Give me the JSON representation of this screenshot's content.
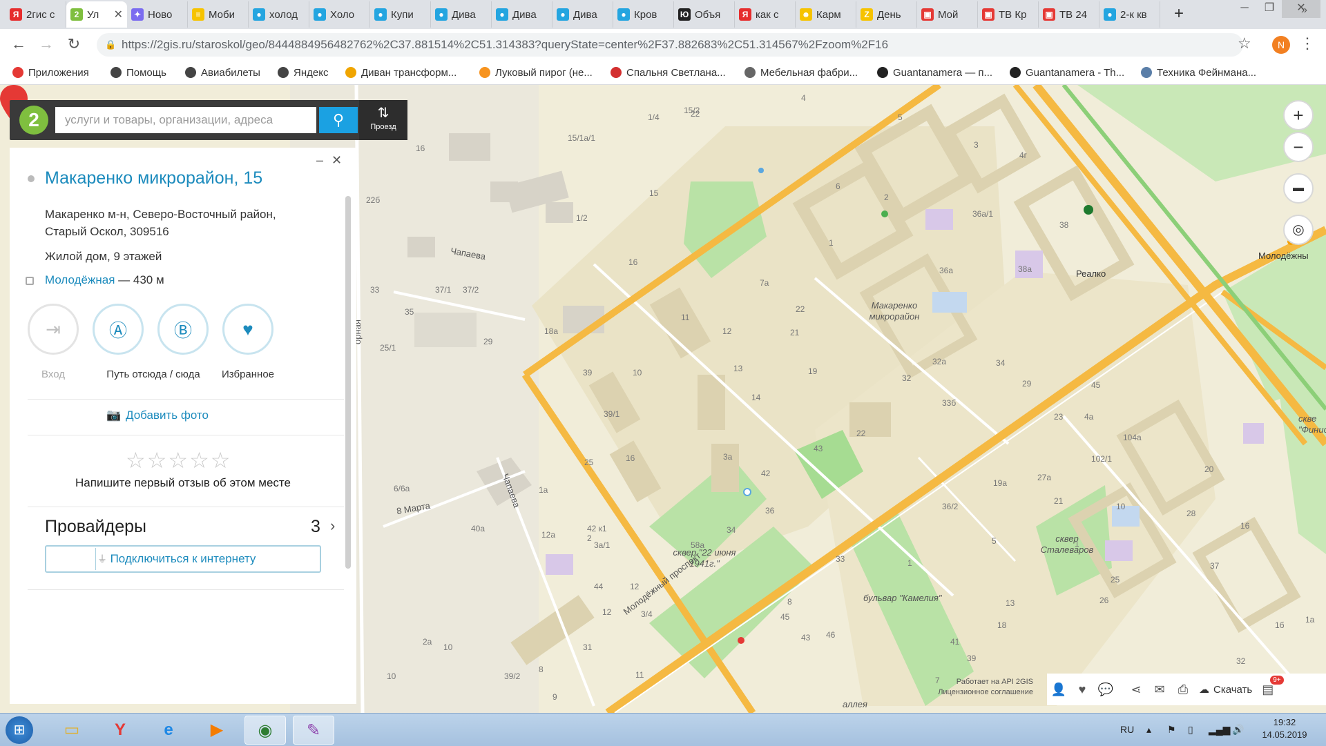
{
  "browser": {
    "tabs": [
      {
        "label": "2гис с",
        "icon": "yandex-icon",
        "color": "#e62d2d",
        "glyph": "Я"
      },
      {
        "label": "Ул",
        "icon": "2gis-icon",
        "color": "#7fbf3f",
        "glyph": "2",
        "active": true
      },
      {
        "label": "Ново",
        "icon": "gemini-icon",
        "color": "#7b6cf0",
        "glyph": "✦"
      },
      {
        "label": "Моби",
        "icon": "beeline-icon",
        "color": "#f6c300",
        "glyph": "≡"
      },
      {
        "label": "холод",
        "icon": "avito-icon",
        "color": "#24a5e0",
        "glyph": "●"
      },
      {
        "label": "Холо",
        "icon": "avito-icon",
        "color": "#24a5e0",
        "glyph": "●"
      },
      {
        "label": "Купи",
        "icon": "avito-icon",
        "color": "#24a5e0",
        "glyph": "●"
      },
      {
        "label": "Дива",
        "icon": "avito-icon",
        "color": "#24a5e0",
        "glyph": "●"
      },
      {
        "label": "Дива",
        "icon": "avito-icon",
        "color": "#24a5e0",
        "glyph": "●"
      },
      {
        "label": "Дива",
        "icon": "avito-icon",
        "color": "#24a5e0",
        "glyph": "●"
      },
      {
        "label": "Кров",
        "icon": "avito-icon",
        "color": "#24a5e0",
        "glyph": "●"
      },
      {
        "label": "Объя",
        "icon": "youla-icon",
        "color": "#222222",
        "glyph": "Ю"
      },
      {
        "label": "как с",
        "icon": "yandex-icon",
        "color": "#e62d2d",
        "glyph": "Я"
      },
      {
        "label": "Карм",
        "icon": "smile-icon",
        "color": "#f6c300",
        "glyph": "☻"
      },
      {
        "label": "День",
        "icon": "yandex-zen-icon",
        "color": "#f6c300",
        "glyph": "Z"
      },
      {
        "label": "Мой",
        "icon": "tv-icon",
        "color": "#e53935",
        "glyph": "▣"
      },
      {
        "label": "ТВ Кр",
        "icon": "tv-icon",
        "color": "#e53935",
        "glyph": "▣"
      },
      {
        "label": "ТВ 24",
        "icon": "tv-icon",
        "color": "#e53935",
        "glyph": "▣"
      },
      {
        "label": "2-к кв",
        "icon": "avito-icon",
        "color": "#24a5e0",
        "glyph": "●"
      }
    ],
    "url": "https://2gis.ru/staroskol/geo/8444884956482762%2C37.881514%2C51.314383?queryState=center%2F37.882683%2C51.314567%2Fzoom%2F16",
    "profile_initial": "N",
    "bookmarks": [
      {
        "label": "Приложения",
        "icon": "apps-grid-icon",
        "color": "#e53935"
      },
      {
        "label": "Помощь",
        "icon": "globe-icon",
        "color": "#444444"
      },
      {
        "label": "Авиабилеты",
        "icon": "globe-icon",
        "color": "#444444"
      },
      {
        "label": "Яндекс",
        "icon": "globe-icon",
        "color": "#444444"
      },
      {
        "label": "Диван трансформ...",
        "icon": "sofa-icon",
        "color": "#f0a500"
      },
      {
        "label": "Луковый пирог (не...",
        "icon": "odnoklassniki-icon",
        "color": "#f7931e"
      },
      {
        "label": "Спальня Светлана...",
        "icon": "bookmark-icon",
        "color": "#d32f2f"
      },
      {
        "label": "Мебельная фабри...",
        "icon": "bookmark-icon",
        "color": "#666666"
      },
      {
        "label": "Guantanamera — п...",
        "icon": "youtube-icon",
        "color": "#222222"
      },
      {
        "label": "Guantanamera - Th...",
        "icon": "youtube-icon",
        "color": "#222222"
      },
      {
        "label": "Техника Фейнмана...",
        "icon": "book-icon",
        "color": "#5a7ea8"
      }
    ]
  },
  "search": {
    "placeholder": "услуги и товары, организации, адреса",
    "route_label": "Проезд"
  },
  "card": {
    "title": "Макаренко микрорайон, 15",
    "address_line1": "Макаренко м-н, Северо-Восточный район,",
    "address_line2": "Старый Оскол, 309516",
    "building_type": "Жилой дом, 9 этажей",
    "stop_name": "Молодёжная",
    "stop_distance": "— 430 м",
    "actions": {
      "entrance": "Вход",
      "route": "Путь отсюда / сюда",
      "favorites": "Избранное"
    },
    "add_photo": "Добавить фото",
    "review_prompt": "Напишите первый отзыв об этом месте",
    "providers_title": "Провайдеры",
    "providers_count": "3",
    "connect_label": "Подключиться к интернету"
  },
  "map": {
    "labels": {
      "district": "Макаренко микрорайон",
      "realko": "Реалко",
      "molodezhny": "Молодёжны",
      "chapaeva1": "Чапаева",
      "chapaeva2": "Чапаева",
      "march8": "8 Марта",
      "prospekt": "Молодёжный проспект",
      "skver22": "сквер \"22 июня 1941г.\"",
      "skverStal": "сквер Сталеваров",
      "bulvar": "бульвар \"Камелия\"",
      "ornaya": "орная",
      "skverRight": "скве \"Финис",
      "alleya": "аллея"
    },
    "houses": [
      "15/2",
      "22",
      "4",
      "5",
      "1/4",
      "15/1а/1",
      "16",
      "3",
      "22б",
      "1/2",
      "4г",
      "6",
      "2",
      "36а/1",
      "38",
      "15",
      "16",
      "1",
      "36а",
      "38а",
      "7а",
      "22",
      "11",
      "12",
      "21",
      "37/1",
      "37/2",
      "35",
      "18а",
      "25/1",
      "33",
      "29",
      "10",
      "39",
      "13",
      "19",
      "32а",
      "34",
      "32",
      "33б",
      "14",
      "29",
      "45",
      "39/1",
      "22",
      "23",
      "4а",
      "43",
      "3а",
      "16",
      "25",
      "27а",
      "104а",
      "6/6а",
      "1а",
      "42",
      "19а",
      "21",
      "36/2",
      "10",
      "28",
      "20",
      "1",
      "102/1",
      "3а/1",
      "42 к1",
      "40а",
      "58а",
      "34",
      "36",
      "33",
      "5",
      "1",
      "16",
      "12а",
      "2",
      "44",
      "12",
      "8",
      "13",
      "12",
      "3/4",
      "45",
      "43",
      "46",
      "41",
      "39",
      "18",
      "37",
      "26",
      "25",
      "2а",
      "10",
      "31",
      "32",
      "1б",
      "1а",
      "11",
      "10",
      "9",
      "8",
      "39/2",
      "7"
    ],
    "credits_line1": "Работает на API 2GIS",
    "credits_line2": "Лицензионное соглашение",
    "download_label": "Скачать",
    "notif_badge": "9+"
  },
  "taskbar": {
    "lang": "RU",
    "time": "19:32",
    "date": "14.05.2019"
  },
  "colors": {
    "accent": "#1ba1e2",
    "link": "#1c8bbd",
    "road": "#f5b942",
    "park": "#9fd88a",
    "marker": "#e53935",
    "brand_green": "#7fbf3f"
  }
}
